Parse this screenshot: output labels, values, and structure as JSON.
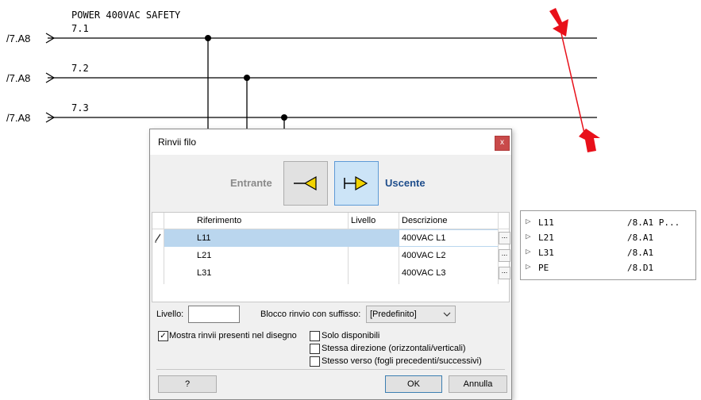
{
  "schematic": {
    "title": "POWER 400VAC SAFETY",
    "wires": [
      {
        "ref": "/7.A8",
        "label": "7.1"
      },
      {
        "ref": "/7.A8",
        "label": "7.2"
      },
      {
        "ref": "/7.A8",
        "label": "7.3"
      }
    ],
    "accent_color": "#e8101a"
  },
  "dialog": {
    "title": "Rinvii filo",
    "close_label": "x",
    "incoming_label": "Entrante",
    "outgoing_label": "Uscente",
    "selected_direction": "Uscente",
    "columns": [
      "Riferimento",
      "Livello",
      "Descrizione"
    ],
    "rows": [
      {
        "riferimento": "L11",
        "livello": "",
        "descrizione": "400VAC L1",
        "ellipsis": "..."
      },
      {
        "riferimento": "L21",
        "livello": "",
        "descrizione": "400VAC L2",
        "ellipsis": "..."
      },
      {
        "riferimento": "L31",
        "livello": "",
        "descrizione": "400VAC L3",
        "ellipsis": "..."
      }
    ],
    "level_label": "Livello:",
    "level_value": "",
    "suffix_label": "Blocco rinvio con suffisso:",
    "suffix_value": "[Predefinito]",
    "show_existing_label": "Mostra rinvii presenti nel disegno",
    "show_existing_checked": true,
    "only_available_label": "Solo disponibili",
    "same_direction_label": "Stessa direzione (orizzontali/verticali)",
    "same_verse_label": "Stesso verso (fogli precedenti/successivi)",
    "help_label": "?",
    "ok_label": "OK",
    "cancel_label": "Annulla"
  },
  "side_panel": [
    {
      "name": "L11",
      "ref": "/8.A1 P..."
    },
    {
      "name": "L21",
      "ref": "/8.A1"
    },
    {
      "name": "L31",
      "ref": "/8.A1"
    },
    {
      "name": "PE",
      "ref": "/8.D1"
    }
  ]
}
